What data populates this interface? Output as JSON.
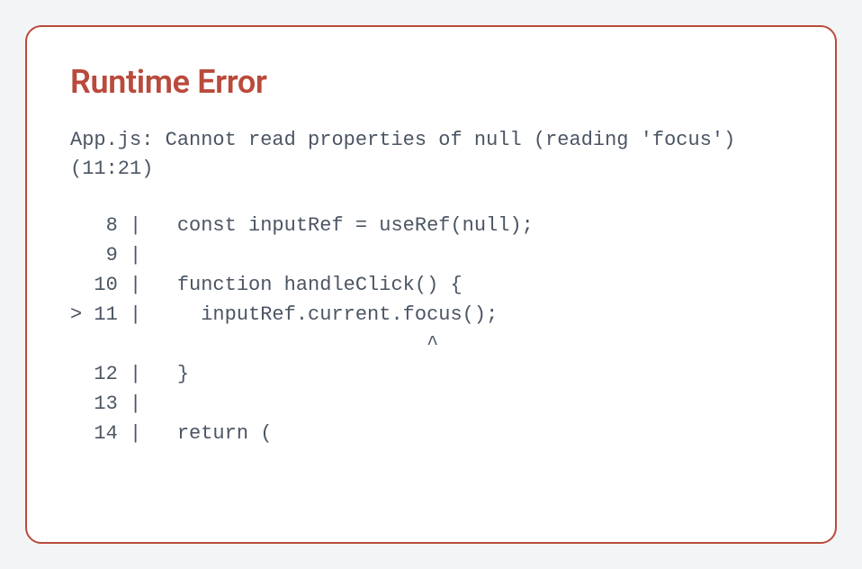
{
  "error": {
    "title": "Runtime Error",
    "message": "App.js: Cannot read properties of null (reading 'focus') (11:21)",
    "codeFrame": "   8 |   const inputRef = useRef(null);\n   9 |\n  10 |   function handleClick() {\n> 11 |     inputRef.current.focus();\n                              ^\n  12 |   }\n  13 |\n  14 |   return ("
  },
  "colors": {
    "errorBorder": "#b94a3c",
    "errorText": "#b94a3c",
    "codeText": "#4b5563",
    "panelBg": "#ffffff",
    "pageBg": "#f3f4f6"
  }
}
